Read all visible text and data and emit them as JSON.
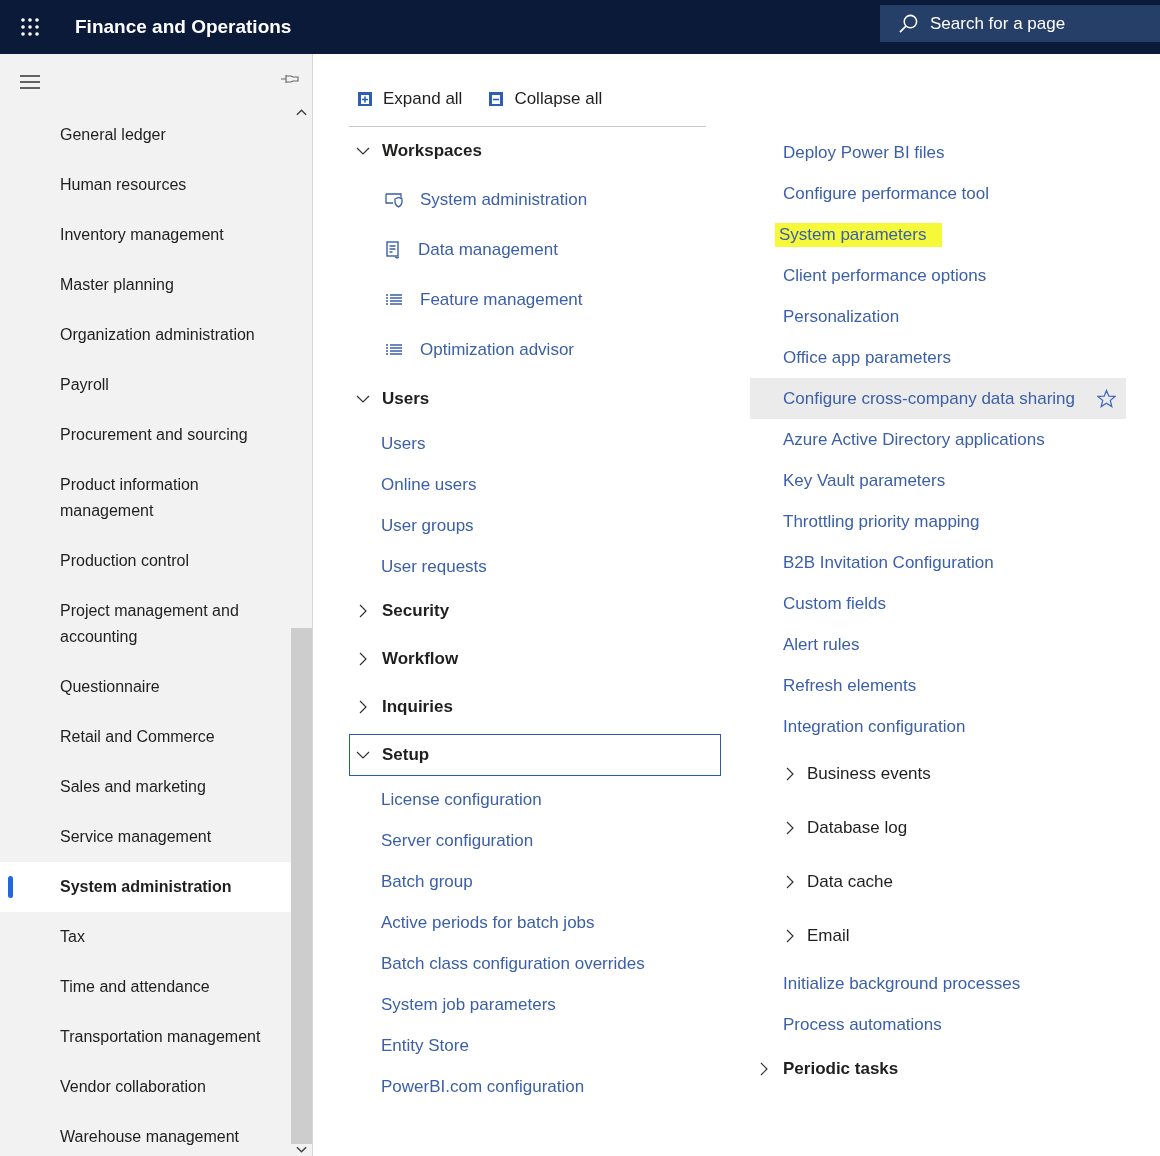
{
  "header": {
    "title": "Finance and Operations",
    "search": {
      "placeholder": "Search for a page"
    }
  },
  "sidebar": {
    "items": [
      {
        "label": "General ledger",
        "selected": false
      },
      {
        "label": "Human resources",
        "selected": false
      },
      {
        "label": "Inventory management",
        "selected": false
      },
      {
        "label": "Master planning",
        "selected": false
      },
      {
        "label": "Organization administration",
        "selected": false
      },
      {
        "label": "Payroll",
        "selected": false
      },
      {
        "label": "Procurement and sourcing",
        "selected": false
      },
      {
        "label": "Product information management",
        "selected": false
      },
      {
        "label": "Production control",
        "selected": false
      },
      {
        "label": "Project management and accounting",
        "selected": false
      },
      {
        "label": "Questionnaire",
        "selected": false
      },
      {
        "label": "Retail and Commerce",
        "selected": false
      },
      {
        "label": "Sales and marketing",
        "selected": false
      },
      {
        "label": "Service management",
        "selected": false
      },
      {
        "label": "System administration",
        "selected": true
      },
      {
        "label": "Tax",
        "selected": false
      },
      {
        "label": "Time and attendance",
        "selected": false
      },
      {
        "label": "Transportation management",
        "selected": false
      },
      {
        "label": "Vendor collaboration",
        "selected": false
      },
      {
        "label": "Warehouse management",
        "selected": false
      }
    ]
  },
  "toolbar": {
    "expand_all": "Expand all",
    "collapse_all": "Collapse all"
  },
  "left_column": [
    {
      "label": "Workspaces",
      "expanded": true,
      "focused": false,
      "children": [
        {
          "kind": "workspace",
          "label": "System administration"
        },
        {
          "kind": "workspace",
          "label": "Data management"
        },
        {
          "kind": "workspace",
          "label": "Feature management"
        },
        {
          "kind": "workspace",
          "label": "Optimization advisor"
        }
      ]
    },
    {
      "label": "Users",
      "expanded": true,
      "focused": false,
      "children": [
        {
          "kind": "link",
          "label": "Users"
        },
        {
          "kind": "link",
          "label": "Online users"
        },
        {
          "kind": "link",
          "label": "User groups"
        },
        {
          "kind": "link",
          "label": "User requests"
        }
      ]
    },
    {
      "label": "Security",
      "expanded": false,
      "focused": false
    },
    {
      "label": "Workflow",
      "expanded": false,
      "focused": false
    },
    {
      "label": "Inquiries",
      "expanded": false,
      "focused": false
    },
    {
      "label": "Setup",
      "expanded": true,
      "focused": true,
      "children": [
        {
          "kind": "link",
          "label": "License configuration"
        },
        {
          "kind": "link",
          "label": "Server configuration"
        },
        {
          "kind": "link",
          "label": "Batch group"
        },
        {
          "kind": "link",
          "label": "Active periods for batch jobs"
        },
        {
          "kind": "link",
          "label": "Batch class configuration overrides"
        },
        {
          "kind": "link",
          "label": "System job parameters"
        },
        {
          "kind": "link",
          "label": "Entity Store"
        },
        {
          "kind": "link",
          "label": "PowerBI.com configuration"
        }
      ]
    }
  ],
  "right_column": {
    "setup_continued": [
      {
        "kind": "link",
        "label": "Deploy Power BI files",
        "highlighted": false,
        "hovered": false
      },
      {
        "kind": "link",
        "label": "Configure performance tool",
        "highlighted": false,
        "hovered": false
      },
      {
        "kind": "link",
        "label": "System parameters",
        "highlighted": true,
        "hovered": false
      },
      {
        "kind": "link",
        "label": "Client performance options",
        "highlighted": false,
        "hovered": false
      },
      {
        "kind": "link",
        "label": "Personalization",
        "highlighted": false,
        "hovered": false
      },
      {
        "kind": "link",
        "label": "Office app parameters",
        "highlighted": false,
        "hovered": false
      },
      {
        "kind": "link",
        "label": "Configure cross-company data sharing",
        "highlighted": false,
        "hovered": true
      },
      {
        "kind": "link",
        "label": "Azure Active Directory applications",
        "highlighted": false,
        "hovered": false
      },
      {
        "kind": "link",
        "label": "Key Vault parameters",
        "highlighted": false,
        "hovered": false
      },
      {
        "kind": "link",
        "label": "Throttling priority mapping",
        "highlighted": false,
        "hovered": false
      },
      {
        "kind": "link",
        "label": "B2B Invitation Configuration",
        "highlighted": false,
        "hovered": false
      },
      {
        "kind": "link",
        "label": "Custom fields",
        "highlighted": false,
        "hovered": false
      },
      {
        "kind": "link",
        "label": "Alert rules",
        "highlighted": false,
        "hovered": false
      },
      {
        "kind": "link",
        "label": "Refresh elements",
        "highlighted": false,
        "hovered": false
      },
      {
        "kind": "link",
        "label": "Integration configuration",
        "highlighted": false,
        "hovered": false
      },
      {
        "kind": "group",
        "label": "Business events",
        "expanded": false
      },
      {
        "kind": "group",
        "label": "Database log",
        "expanded": false
      },
      {
        "kind": "group",
        "label": "Data cache",
        "expanded": false
      },
      {
        "kind": "group",
        "label": "Email",
        "expanded": false
      },
      {
        "kind": "link",
        "label": "Initialize background processes",
        "highlighted": false,
        "hovered": false
      },
      {
        "kind": "link",
        "label": "Process automations",
        "highlighted": false,
        "hovered": false
      }
    ],
    "groups": [
      {
        "label": "Periodic tasks",
        "expanded": false,
        "focused": false
      }
    ]
  }
}
